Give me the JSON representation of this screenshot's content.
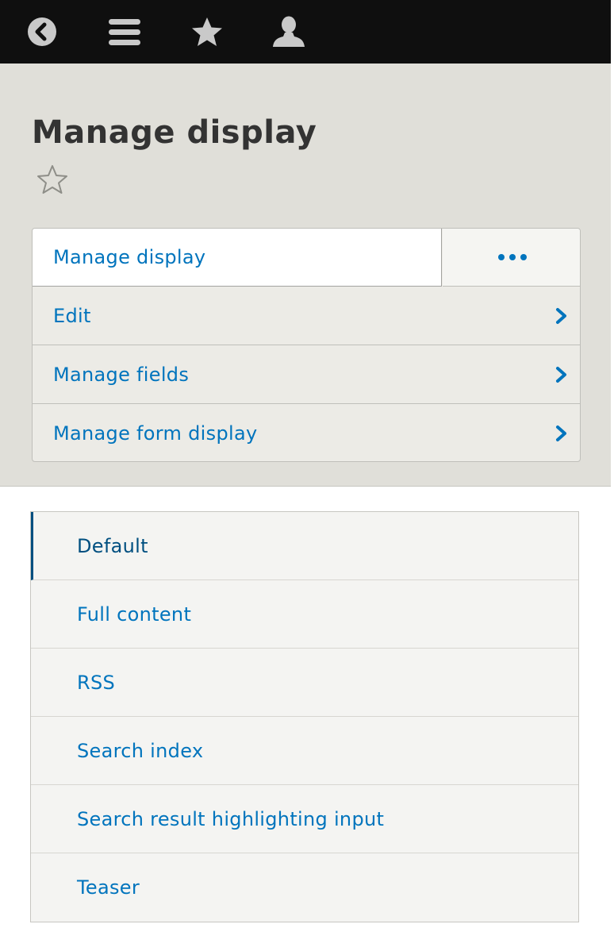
{
  "toolbar": {
    "items": [
      {
        "icon": "back-icon"
      },
      {
        "icon": "menu-icon"
      },
      {
        "icon": "star-icon"
      },
      {
        "icon": "user-icon"
      }
    ]
  },
  "page": {
    "title": "Manage display"
  },
  "local_tasks": {
    "active": "Manage display",
    "more_icon": "more-icon",
    "items": [
      {
        "label": "Edit"
      },
      {
        "label": "Manage fields"
      },
      {
        "label": "Manage form display"
      }
    ]
  },
  "view_modes": {
    "selected": "Default",
    "items": [
      {
        "label": "Default"
      },
      {
        "label": "Full content"
      },
      {
        "label": "RSS"
      },
      {
        "label": "Search index"
      },
      {
        "label": "Search result highlighting input"
      },
      {
        "label": "Teaser"
      }
    ]
  },
  "colors": {
    "toolbar_bg": "#0f0f0f",
    "header_bg": "#e0dfd9",
    "link": "#0074bd",
    "link_active": "#004f80",
    "title": "#333333"
  }
}
